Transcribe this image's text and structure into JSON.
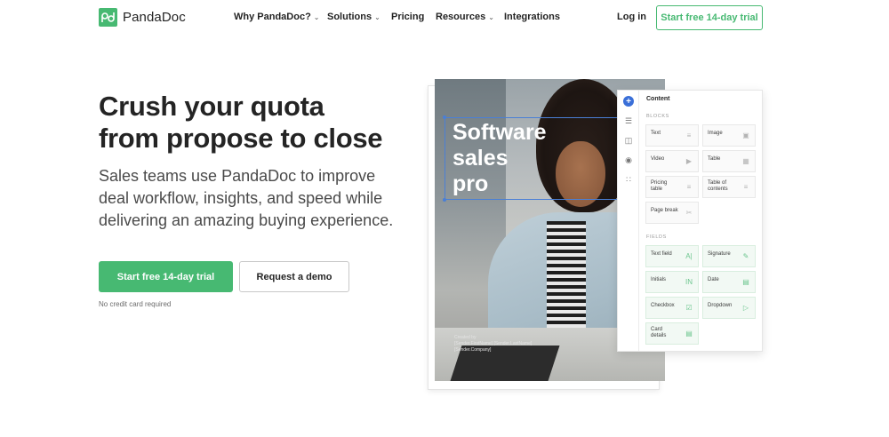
{
  "nav": {
    "brand": "PandaDoc",
    "links": [
      {
        "label": "Why PandaDoc?",
        "dropdown": true
      },
      {
        "label": "Solutions",
        "dropdown": true
      },
      {
        "label": "Pricing",
        "dropdown": false
      },
      {
        "label": "Resources",
        "dropdown": true
      },
      {
        "label": "Integrations",
        "dropdown": false
      }
    ],
    "login": "Log in",
    "cta": "Start free 14-day trial"
  },
  "hero": {
    "title_lines": [
      "Crush your quota",
      "from propose to close"
    ],
    "subtitle_lines": [
      "Sales teams use PandaDoc to improve",
      "deal workflow, insights, and speed while",
      "delivering an amazing buying experience."
    ],
    "primary_button": "Start free 14-day trial",
    "secondary_button": "Request a demo",
    "note": "No credit card required"
  },
  "document": {
    "overlay_lines": [
      "Software",
      "sales",
      "pro"
    ],
    "footer_lines": [
      "Created by",
      "[Sender.FirstName] [Sender.LastName]",
      "[Sender.Company]"
    ]
  },
  "panel": {
    "title": "Content",
    "blocks_heading": "BLOCKS",
    "blocks": [
      {
        "label": "Text",
        "icon": "text-block-icon"
      },
      {
        "label": "Image",
        "icon": "image-block-icon"
      },
      {
        "label": "Video",
        "icon": "video-block-icon"
      },
      {
        "label": "Table",
        "icon": "table-block-icon"
      },
      {
        "label": "Pricing\ntable",
        "icon": "pricing-table-icon"
      },
      {
        "label": "Table of\ncontents",
        "icon": "toc-icon"
      },
      {
        "label": "Page break",
        "icon": "page-break-icon"
      }
    ],
    "fields_heading": "FIELDS",
    "fields": [
      {
        "label": "Text field",
        "icon": "text-field-icon"
      },
      {
        "label": "Signature",
        "icon": "signature-icon"
      },
      {
        "label": "Initials",
        "icon": "initials-icon"
      },
      {
        "label": "Date",
        "icon": "date-icon"
      },
      {
        "label": "Checkbox",
        "icon": "checkbox-icon"
      },
      {
        "label": "Dropdown",
        "icon": "dropdown-icon"
      },
      {
        "label": "Card\ndetails",
        "icon": "card-details-icon"
      }
    ]
  },
  "colors": {
    "brand_green": "#47b972",
    "text_dark": "#242424",
    "selection_blue": "#4a7fd6"
  }
}
